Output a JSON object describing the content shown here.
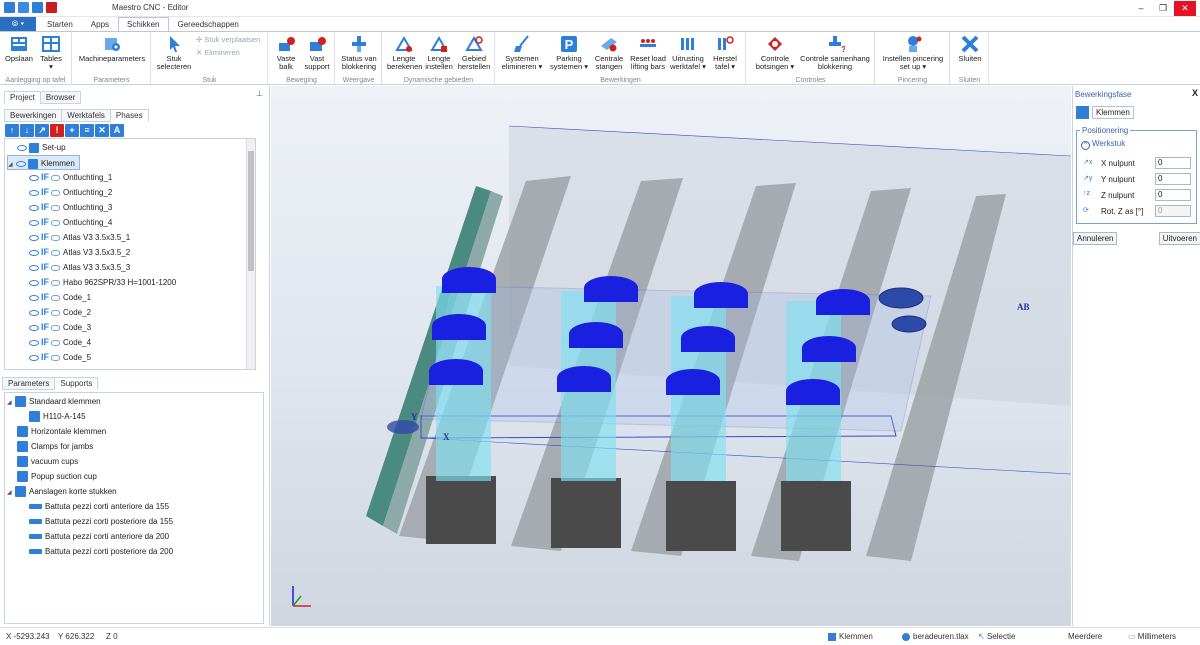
{
  "window": {
    "title": "Maestro CNC - Editor"
  },
  "tabs": {
    "app": "⦾ ▾",
    "items": [
      "Starten",
      "Apps",
      "Schikken",
      "Gereedschappen"
    ],
    "active": "Schikken"
  },
  "ribbon": {
    "groups": [
      {
        "title": "Aanlegging op tafel",
        "buttons": [
          "Opslaan",
          "Tables"
        ]
      },
      {
        "title": "Parameters",
        "buttons": [
          "Machineparameters"
        ]
      },
      {
        "title": "Stuk",
        "buttons": [
          "Stuk selecteren"
        ],
        "small": [
          "Stuk verplaatsen",
          "Elimineren"
        ]
      },
      {
        "title": "Beweging",
        "buttons": [
          "Vaste balk",
          "Vast support"
        ]
      },
      {
        "title": "Weergave",
        "buttons": [
          "Status van blokkering"
        ]
      },
      {
        "title": "Dynamische gebieden",
        "buttons": [
          "Lengte berekenen",
          "Lengte instellen",
          "Gebied herstellen"
        ]
      },
      {
        "title": "Bewerkingen",
        "buttons": [
          "Systemen elimineren ▾",
          "Parking systemen ▾",
          "Centrale stangen",
          "Reset load lifting bars",
          "Uitrusting werktafel ▾",
          "Herstel tafel ▾"
        ]
      },
      {
        "title": "Controles",
        "buttons": [
          "Controle botsingen ▾",
          "Controle samenhang blokkering"
        ]
      },
      {
        "title": "Pincering",
        "buttons": [
          "Instellen pincering set up ▾"
        ]
      },
      {
        "title": "Sluiten",
        "buttons": [
          "Sluiten"
        ]
      }
    ]
  },
  "left": {
    "tabs_top": [
      "Project",
      "Browser"
    ],
    "tabs_sub": [
      "Bewerkingen",
      "Werktafels",
      "Phases"
    ],
    "tree": [
      "Set-up",
      "Klemmen",
      "Ontluchting_1",
      "Ontluchting_2",
      "Ontluchting_3",
      "Ontluchting_4",
      "Atlas V3 3.5x3.5_1",
      "Atlas V3 3.5x3.5_2",
      "Atlas V3 3.5x3.5_3",
      "Habo 962SPR/33  H=1001-1200",
      "Code_1",
      "Code_2",
      "Code_3",
      "Code_4",
      "Code_5"
    ],
    "if_label": "IF",
    "tabs_bottom": [
      "Parameters",
      "Supports"
    ],
    "supports": [
      "Standaard klemmen",
      "H110-A-145",
      "Horizontale klemmen",
      "Clamps for jambs",
      "vacuum cups",
      "Popup suction cup",
      "Aanslagen korte stukken",
      "Battuta pezzi corti anteriore da 155",
      "Battuta pezzi corti posteriore da 155",
      "Battuta pezzi corti anteriore da 200",
      "Battuta pezzi corti posteriore da 200"
    ]
  },
  "viewport": {
    "label": "AB",
    "axis_x": "X",
    "axis_y": "Y"
  },
  "right": {
    "title": "Bewerkingsfase",
    "phase": "Klemmen",
    "group": "Positionering",
    "sub": "Werkstuk",
    "fields": [
      {
        "label": "X nulpunt",
        "value": "0"
      },
      {
        "label": "Y nulpunt",
        "value": "0"
      },
      {
        "label": "Z nulpunt",
        "value": "0"
      },
      {
        "label": "Rot. Z as [°]",
        "value": "0"
      }
    ],
    "cancel": "Annuleren",
    "execute": "Uitvoeren"
  },
  "status": {
    "x": "X  -5293.243",
    "y": "Y  626.322",
    "z": "Z  0",
    "phase": "Klemmen",
    "file": "beradeuren.tlax",
    "mode": "Selectie",
    "more": "Meerdere",
    "unit": "Millimeters"
  }
}
